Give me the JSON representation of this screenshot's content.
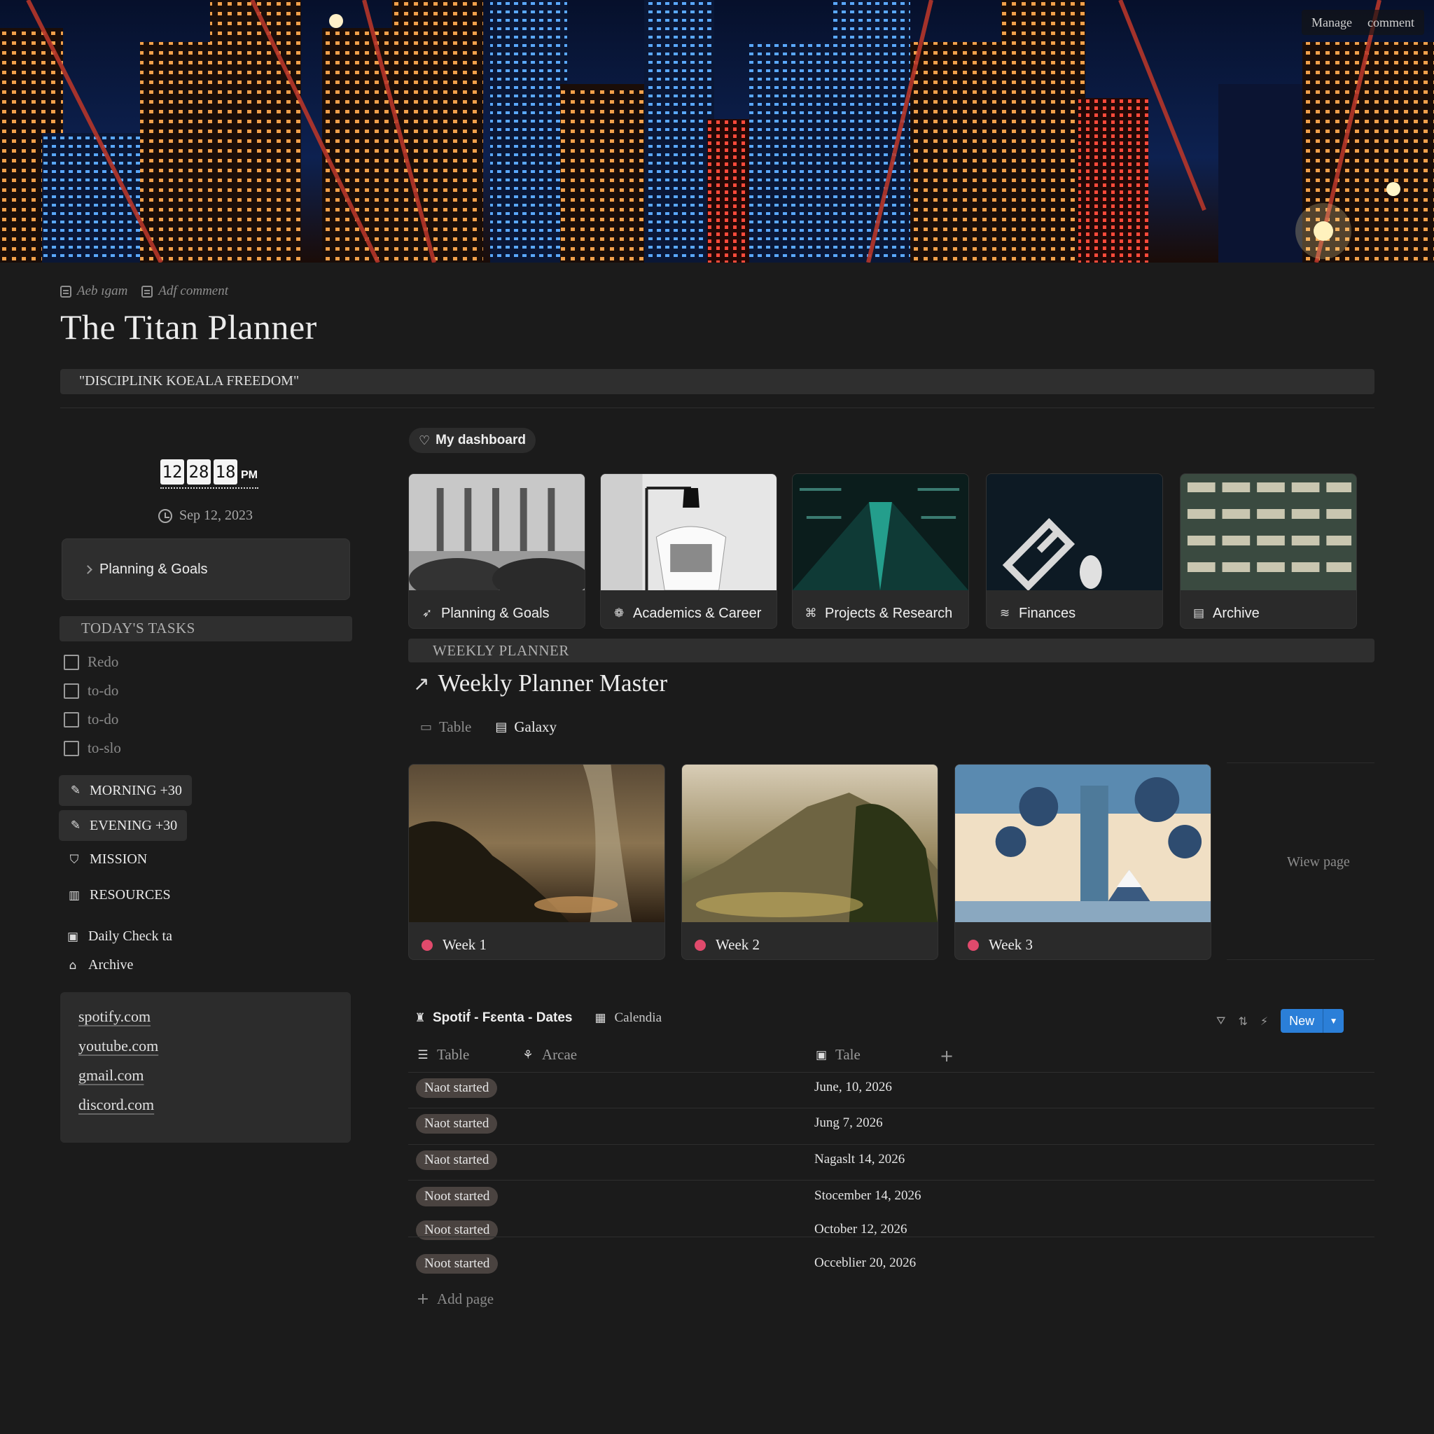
{
  "cover": {
    "actions": [
      "Manage",
      "comment"
    ]
  },
  "meta_links": [
    "Aeb ıgam",
    "Adf comment"
  ],
  "page_title": "The Titan Planner",
  "quote": "\"DISCIPLINK KOEALA FREEDOM\"",
  "clock": {
    "digits": [
      "12",
      "28",
      "18"
    ],
    "ampm": "PM",
    "date": "Sep 12, 2023"
  },
  "sidebar": {
    "toggle_label": "Planning & Goals",
    "tasks_header": "TODAY'S TASKS",
    "tasks": [
      "Redo",
      "to-do",
      "to-do",
      "to-slo"
    ],
    "buttons": [
      {
        "label": "MORNING +30",
        "icon": "brush-icon"
      },
      {
        "label": "EVENING +30",
        "icon": "brush-icon"
      }
    ],
    "items": [
      {
        "label": "MISSION",
        "icon": "shield-icon"
      },
      {
        "label": "RESOURCES",
        "icon": "building-icon"
      }
    ],
    "pages": [
      {
        "label": "Daily Check ta",
        "icon": "calendar-icon"
      },
      {
        "label": "Archive",
        "icon": "house-icon"
      }
    ],
    "links": [
      "spotify.com",
      "youtube.com",
      "gmail.com",
      "discord.com"
    ]
  },
  "dashboard": {
    "pill": "My dashboard",
    "cards": [
      {
        "label": "Planning & Goals",
        "icon": "rocket-icon"
      },
      {
        "label": "Academics & Career",
        "icon": "brain-icon"
      },
      {
        "label": "Projects & Research",
        "icon": "network-icon"
      },
      {
        "label": "Finances",
        "icon": "coins-icon"
      },
      {
        "label": "Archive",
        "icon": "document-icon"
      }
    ]
  },
  "weekly": {
    "header": "WEEKLY PLANNER",
    "title": "Weekly Planner Master",
    "views": [
      "Table",
      "Galaxy"
    ],
    "cards": [
      "Week 1",
      "Week 2",
      "Week 3"
    ],
    "view_page": "Wiew page"
  },
  "database": {
    "name": "Spotiḟ - Fɛenta - Dates",
    "alt_view": "Calendia",
    "new_label": "New",
    "columns": [
      "Table",
      "Arcae",
      "Tale"
    ],
    "rows": [
      {
        "status": "Naot started",
        "date": "June, 10, 2026"
      },
      {
        "status": "Naot started",
        "date": "Jung 7, 2026"
      },
      {
        "status": "Naot started",
        "date": "Nagaslt 14, 2026"
      },
      {
        "status": "Noot started",
        "date": "Stocember 14, 2026"
      },
      {
        "status": "Noot started",
        "date": "October 12, 2026"
      },
      {
        "status": "Noot started",
        "date": "Occeblier 20, 2026"
      }
    ],
    "add_page": "Add page"
  },
  "colors": {
    "background": "#1b1b1b",
    "panel": "#2f2f2f",
    "accent_blue": "#2b7fd8",
    "week_dot": "#e04a6c",
    "status_pill": "#4a4340"
  }
}
